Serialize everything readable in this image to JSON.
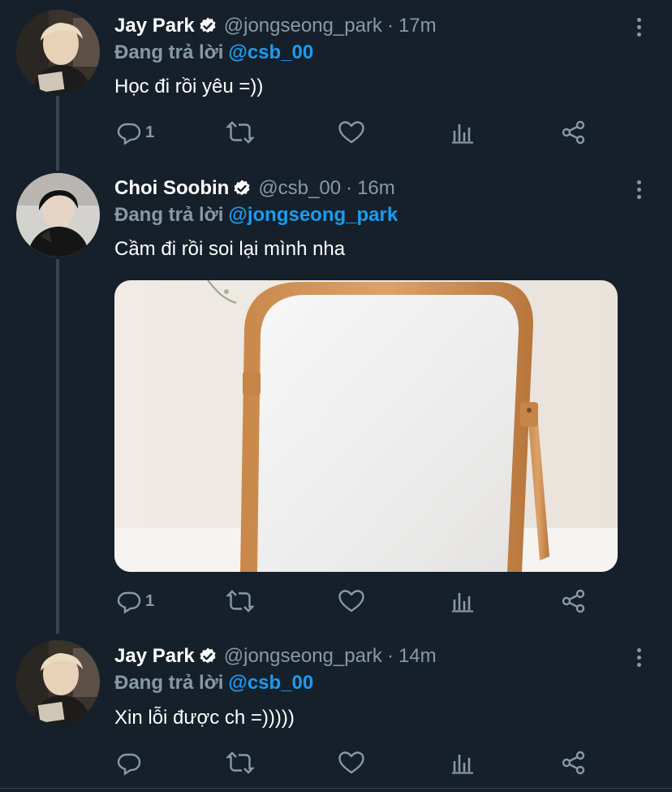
{
  "reply_prefix": "Đang trả lời",
  "tweets": [
    {
      "display_name": "Jay Park",
      "handle": "@jongseong_park",
      "separator": "·",
      "time": "17m",
      "reply_to": "@csb_00",
      "text": "Học đi rồi yêu =))",
      "reply_count": "1",
      "avatar_icon": "avatar-blond-portrait"
    },
    {
      "display_name": "Choi Soobin",
      "handle": "@csb_00",
      "separator": "·",
      "time": "16m",
      "reply_to": "@jongseong_park",
      "text": "Cầm đi rồi soi lại mình nha",
      "reply_count": "1",
      "avatar_icon": "avatar-dark-hair-portrait",
      "media": "wooden-mirror-photo"
    },
    {
      "display_name": "Jay Park",
      "handle": "@jongseong_park",
      "separator": "·",
      "time": "14m",
      "reply_to": "@csb_00",
      "text": "Xin lỗi được ch =)))))",
      "reply_count": "",
      "avatar_icon": "avatar-blond-portrait"
    }
  ],
  "colors": {
    "background": "#15202b",
    "muted": "#8899a6",
    "link": "#1d9bf0",
    "thread_line": "#38444d"
  }
}
